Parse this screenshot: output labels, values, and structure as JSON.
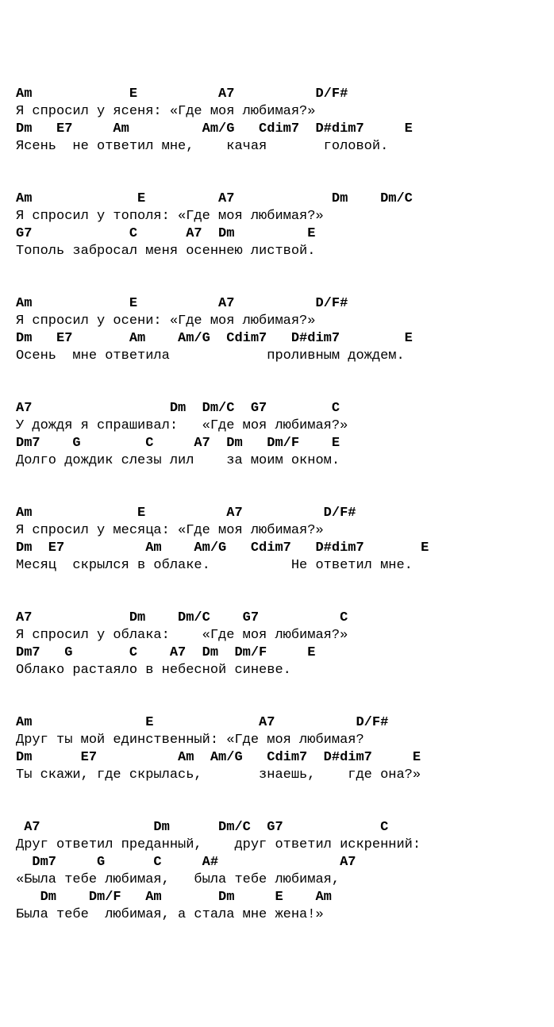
{
  "verses": [
    {
      "lines": [
        {
          "chords": "Am            E          A7          D/F#",
          "lyric": "Я спросил у ясеня: «Где моя любимая?»"
        },
        {
          "chords": "Dm   E7     Am         Am/G   Cdim7  D#dim7     E",
          "lyric": "Ясень  не ответил мне,    качая       головой."
        }
      ]
    },
    {
      "lines": [
        {
          "chords": "Am             E         A7            Dm    Dm/C",
          "lyric": "Я спросил у тополя: «Где моя любимая?»"
        },
        {
          "chords": "G7            C      A7  Dm         E",
          "lyric": "Тополь забросал меня осеннею листвой."
        }
      ]
    },
    {
      "lines": [
        {
          "chords": "Am            E          A7          D/F#",
          "lyric": "Я спросил у осени: «Где моя любимая?»"
        },
        {
          "chords": "Dm   E7       Am    Am/G  Cdim7   D#dim7        E",
          "lyric": "Осень  мне ответила            проливным дождем."
        }
      ]
    },
    {
      "lines": [
        {
          "chords": "A7                 Dm  Dm/C  G7        C",
          "lyric": "У дождя я спрашивал:   «Где моя любимая?»"
        },
        {
          "chords": "Dm7    G        C     A7  Dm   Dm/F    E",
          "lyric": "Долго дождик слезы лил    за моим окном."
        }
      ]
    },
    {
      "lines": [
        {
          "chords": "Am             E          A7          D/F#",
          "lyric": "Я спросил у месяца: «Где моя любимая?»"
        },
        {
          "chords": "Dm  E7          Am    Am/G   Cdim7   D#dim7       E",
          "lyric": "Месяц  скрылся в облаке.          Не ответил мне."
        }
      ]
    },
    {
      "lines": [
        {
          "chords": "A7            Dm    Dm/C    G7          C",
          "lyric": "Я спросил у облака:    «Где моя любимая?»"
        },
        {
          "chords": "Dm7   G       C    A7  Dm  Dm/F     E",
          "lyric": "Облако растаяло в небесной синеве."
        }
      ]
    },
    {
      "lines": [
        {
          "chords": "Am              E             A7          D/F#",
          "lyric": "Друг ты мой единственный: «Где моя любимая?"
        },
        {
          "chords": "Dm      E7          Am  Am/G   Cdim7  D#dim7     E",
          "lyric": "Ты скажи, где скрылась,       знаешь,    где она?»"
        }
      ]
    },
    {
      "lines": [
        {
          "chords": " A7              Dm      Dm/C  G7            C",
          "lyric": "Друг ответил преданный,    друг ответил искренний:"
        },
        {
          "chords": "  Dm7     G      C     A#               A7",
          "lyric": "«Была тебе любимая,   была тебе любимая,"
        },
        {
          "chords": "   Dm    Dm/F   Am       Dm     E    Am",
          "lyric": "Была тебе  любимая, а стала мне жена!»"
        }
      ]
    }
  ]
}
